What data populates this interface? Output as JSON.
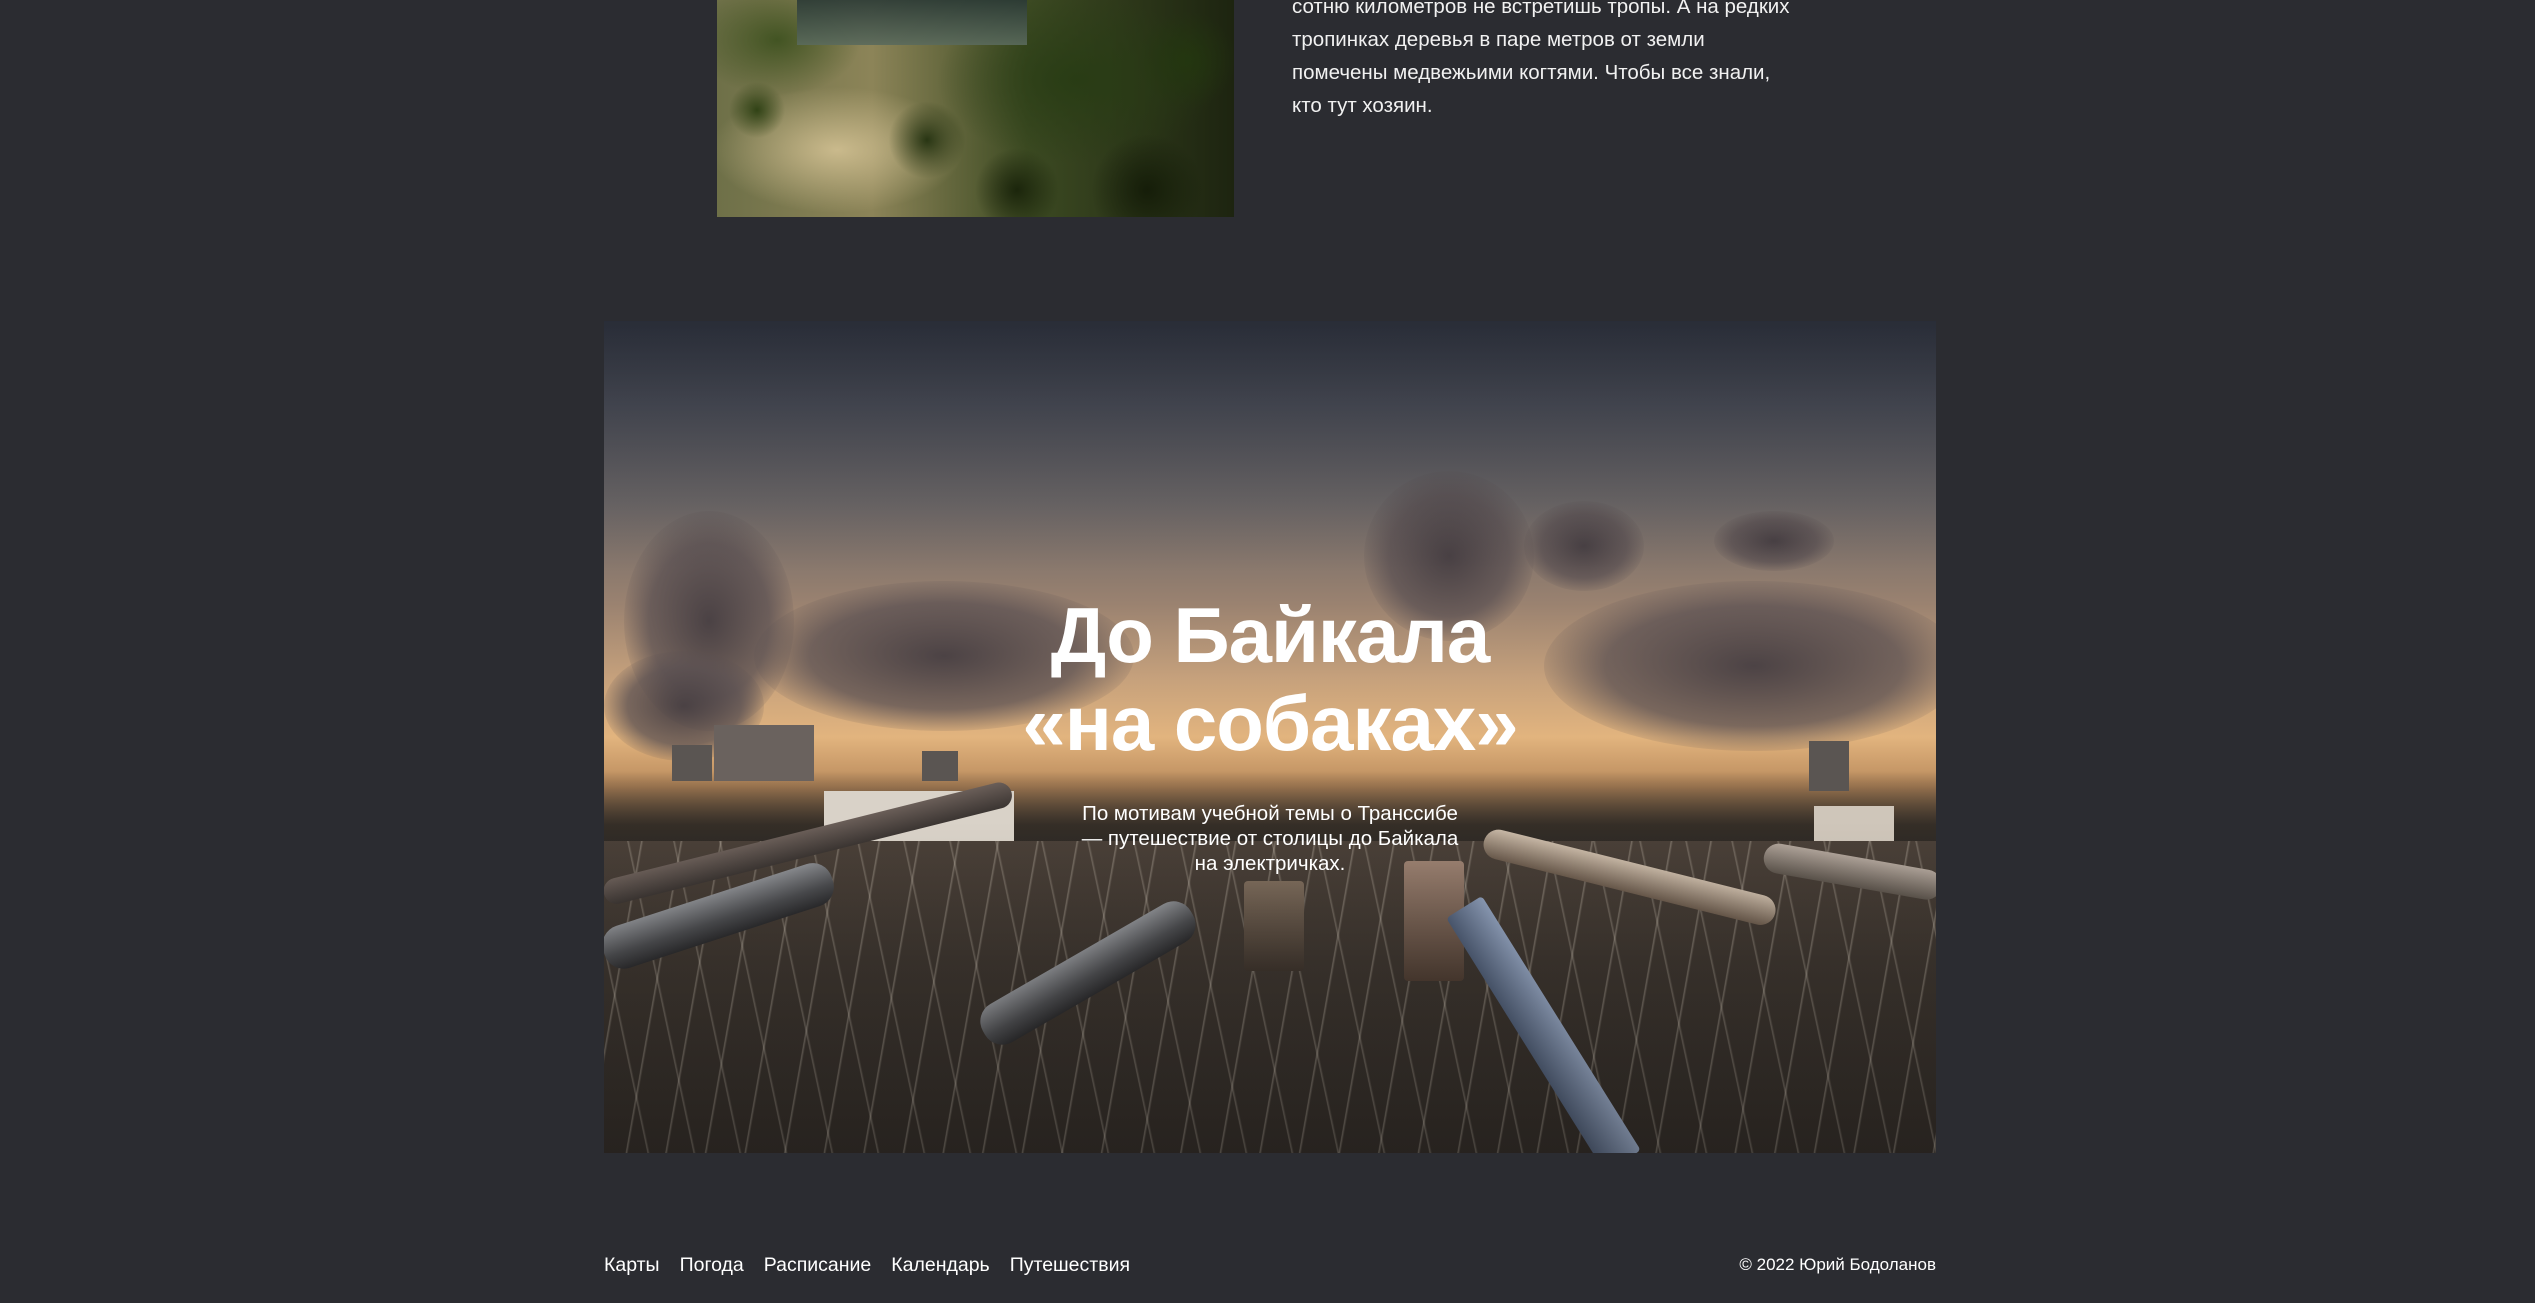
{
  "article": {
    "text_lines": [
      "сотню километров не встретишь тропы. А на редких",
      "тропинках деревья в паре метров от земли",
      "помечены медвежьими когтями. Чтобы все знали,",
      "кто тут хозяин."
    ]
  },
  "hero": {
    "title_line1": "До Байкала",
    "title_line2": "«на собаках»",
    "subtitle_line1": "По мотивам учебной темы о Транссибе",
    "subtitle_line2": "— путешествие от столицы до Байкала",
    "subtitle_line3": "на электричках."
  },
  "footer": {
    "nav": [
      {
        "label": "Карты"
      },
      {
        "label": "Погода"
      },
      {
        "label": "Расписание"
      },
      {
        "label": "Календарь"
      },
      {
        "label": "Путешествия"
      }
    ],
    "copyright": "© 2022 Юрий Бодоланов"
  }
}
